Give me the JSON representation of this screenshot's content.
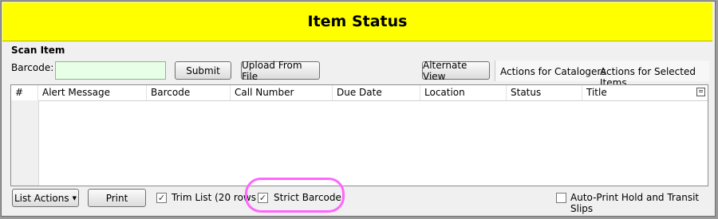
{
  "header": {
    "title": "Item Status"
  },
  "scan": {
    "section_label": "Scan Item",
    "barcode_label": "Barcode:",
    "barcode_value": "",
    "submit_label": "Submit",
    "upload_label": "Upload From File",
    "alternate_view_label": "Alternate View"
  },
  "menus": {
    "catalogers": "Actions for Catalogers",
    "selected_items": "Actions for Selected Items"
  },
  "grid": {
    "columns": [
      "#",
      "Alert Message",
      "Barcode",
      "Call Number",
      "Due Date",
      "Location",
      "Status",
      "Title"
    ],
    "rows": []
  },
  "footer": {
    "list_actions_label": "List Actions",
    "print_label": "Print",
    "trim_list_label": "Trim List (20 rows",
    "trim_list_checked": true,
    "strict_barcode_label": "Strict Barcode",
    "strict_barcode_checked": true,
    "auto_print_label": "Auto-Print Hold and Transit Slips",
    "auto_print_checked": false
  },
  "colors": {
    "header_bg": "#ffff00",
    "highlight": "#ff66ff",
    "barcode_input_bg": "#e6ffe6"
  },
  "icons": {
    "column_picker": "column-picker-icon",
    "dropdown": "dropdown-caret-icon"
  }
}
